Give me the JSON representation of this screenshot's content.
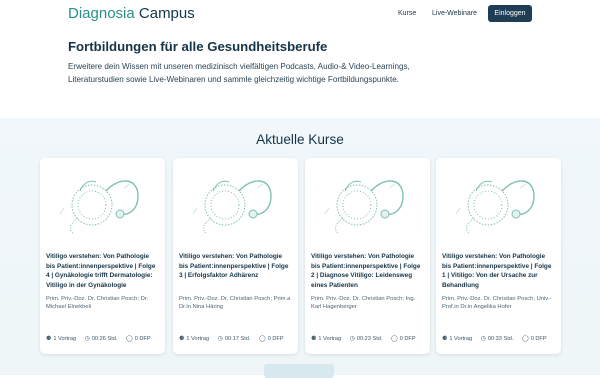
{
  "header": {
    "logo_part1": "Diagnosia",
    "logo_part2": "Campus",
    "nav": [
      "Kurse",
      "Live-Webinare"
    ],
    "login_label": "Einloggen"
  },
  "hero": {
    "title": "Fortbildungen für alle Gesundheitsberufe",
    "text": "Erweitere dein Wissen mit unseren medizinisch vielfältigen Podcasts, Audio-& Video-Learnings, Literaturstudien sowie Live-Webinaren und sammle gleichzeitig wichtige Fortbildungspunkte."
  },
  "courses": {
    "section_title": "Aktuelle Kurse",
    "items": [
      {
        "title": "Vitiligo verstehen: Von Pathologie bis Patient:innenperspektive | Folge 4 | Gynäkologie trifft Dermatologie: Vitiligo in der Gynäkologie",
        "authors": "Prim. Priv.-Doz. Dr. Christian Posch; Dr. Michael Elnekheli",
        "lessons": "1 Vortrag",
        "duration": "00:26 Std.",
        "points": "0 DFP"
      },
      {
        "title": "Vitiligo verstehen: Von Pathologie bis Patient:innenperspektive | Folge 3 | Erfolgsfaktor Adhärenz",
        "authors": "Prim. Priv.-Doz. Dr. Christian Posch; Prim.a Dr.in Nina Häring",
        "lessons": "1 Vortrag",
        "duration": "00:17 Std.",
        "points": "0 DFP"
      },
      {
        "title": "Vitiligo verstehen: Von Pathologie bis Patient:innenperspektive | Folge 2 | Diagnose Vitiligo: Leidensweg eines Patienten",
        "authors": "Prim. Priv.-Doz. Dr. Christian Posch; Ing. Karl Hagenberger",
        "lessons": "1 Vortrag",
        "duration": "00:23 Std.",
        "points": "0 DFP"
      },
      {
        "title": "Vitiligo verstehen: Von Pathologie bis Patient:innenperspektive | Folge 1 | Vitiligo: Von der Ursache zur Behandlung",
        "authors": "Prim. Priv.-Doz. Dr. Christian Posch; Univ.-Prof.in Dr.in Angelika Hofer",
        "lessons": "1 Vortrag",
        "duration": "00:33 Std.",
        "points": "0 DFP"
      }
    ]
  },
  "icons": {
    "lessons": "headphones-icon",
    "duration": "clock-icon",
    "points": "award-icon"
  },
  "colors": {
    "brand_teal": "#2a8f86",
    "brand_navy": "#14344a",
    "button_bg": "#1f3e55",
    "section_bg": "#f1f7fa"
  }
}
